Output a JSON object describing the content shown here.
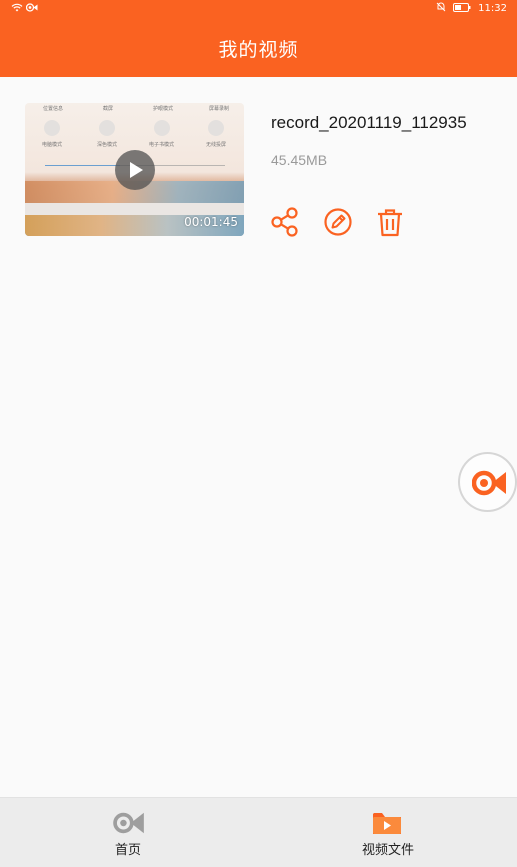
{
  "status_bar": {
    "time": "11:32"
  },
  "header": {
    "title": "我的视频"
  },
  "video": {
    "file_name": "record_20201119_112935",
    "file_size": "45.45MB",
    "duration": "00:01:45",
    "thumbnail_labels": [
      "位置信息",
      "截屏",
      "护眼模式",
      "屏幕录制",
      "电脑模式",
      "深色模式",
      "电子书模式",
      "无线投屏"
    ]
  },
  "bottom_nav": {
    "items": [
      {
        "label": "首页",
        "icon": "recorder-icon"
      },
      {
        "label": "视频文件",
        "icon": "video-folder-icon"
      }
    ]
  },
  "colors": {
    "accent": "#fa6221",
    "icon_gray": "#9e9e9e"
  }
}
